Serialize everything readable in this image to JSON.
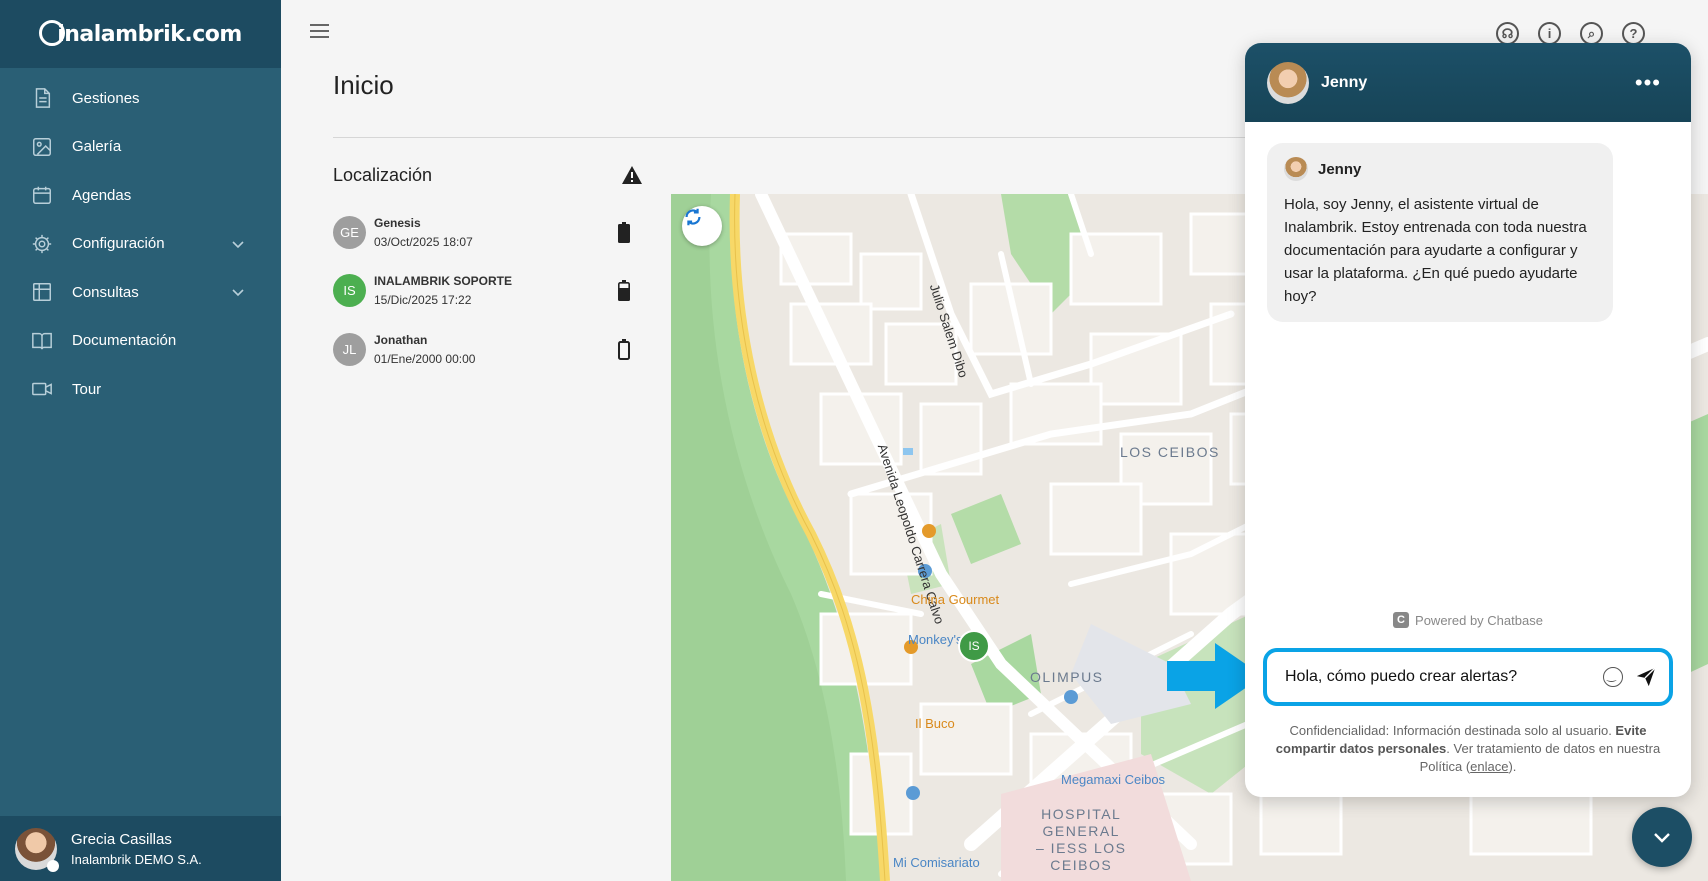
{
  "brand": {
    "name": "inalambrik.com"
  },
  "sidebar": {
    "items": [
      {
        "label": "Gestiones",
        "icon": "document-icon"
      },
      {
        "label": "Galería",
        "icon": "image-icon"
      },
      {
        "label": "Agendas",
        "icon": "calendar-icon"
      },
      {
        "label": "Configuración",
        "icon": "gear-icon",
        "expandable": true
      },
      {
        "label": "Consultas",
        "icon": "table-icon",
        "expandable": true
      },
      {
        "label": "Documentación",
        "icon": "book-icon"
      },
      {
        "label": "Tour",
        "icon": "video-icon"
      }
    ],
    "user": {
      "name": "Grecia Casillas",
      "company": "Inalambrik DEMO S.A."
    }
  },
  "page": {
    "title": "Inicio"
  },
  "location": {
    "title": "Localización",
    "devices": [
      {
        "initials": "GE",
        "name": "Genesis",
        "time": "03/Oct/2025 18:07",
        "color": "#9e9e9e",
        "battery": "high"
      },
      {
        "initials": "IS",
        "name": "INALAMBRIK SOPORTE",
        "time": "15/Dic/2025 17:22",
        "color": "#4caf50",
        "battery": "medium"
      },
      {
        "initials": "JL",
        "name": "Jonathan",
        "time": "01/Ene/2000 00:00",
        "color": "#9e9e9e",
        "battery": "empty"
      }
    ]
  },
  "map": {
    "labels": {
      "los_ceibos": "LOS CEIBOS",
      "olimpus": "OLIMPUS",
      "hospital": "HOSPITAL\nGENERAL\n– IESS LOS\nCEIBOS",
      "china_gourmet": "China Gourmet",
      "monkeys": "Monkey's",
      "il_buco": "Il Buco",
      "megamaxi": "Megamaxi Ceibos",
      "mi_comisariato": "Mi Comisariato",
      "julio_salem": "Julio Salem Dibo",
      "avenida": "Avenida Leopoldo Carrera Calvo"
    },
    "marker": "IS"
  },
  "chat": {
    "agent_name": "Jenny",
    "message_author": "Jenny",
    "message": "Hola, soy Jenny, el asistente virtual de Inalambrik. Estoy entrenada con toda nuestra documentación para ayudarte a configurar y usar la plataforma. ¿En qué puedo ayudarte hoy?",
    "powered_by": "Powered by Chatbase",
    "input_value": "Hola, cómo puedo crear alertas?",
    "disclaimer_prefix": "Confidencialidad: Información destinada solo al usuario. ",
    "disclaimer_bold": "Evite compartir datos personales",
    "disclaimer_mid": ". Ver tratamiento de datos en nuestra Política (",
    "disclaimer_link": "enlace",
    "disclaimer_suffix": ")."
  },
  "colors": {
    "sidebar": "#2a5f75",
    "sidebar_dark": "#1d4b61",
    "accent": "#0aa3e6",
    "arrow": "#0aa3e6"
  }
}
